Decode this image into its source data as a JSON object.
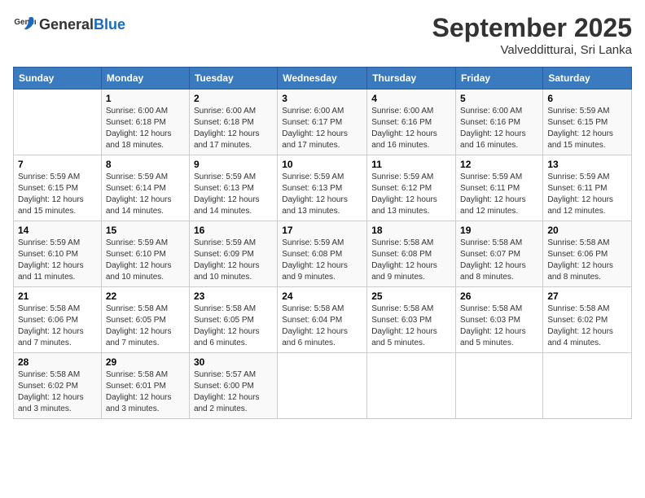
{
  "logo": {
    "general": "General",
    "blue": "Blue"
  },
  "title": "September 2025",
  "subtitle": "Valvedditturai, Sri Lanka",
  "days_of_week": [
    "Sunday",
    "Monday",
    "Tuesday",
    "Wednesday",
    "Thursday",
    "Friday",
    "Saturday"
  ],
  "weeks": [
    [
      {
        "day": "",
        "info": ""
      },
      {
        "day": "1",
        "info": "Sunrise: 6:00 AM\nSunset: 6:18 PM\nDaylight: 12 hours\nand 18 minutes."
      },
      {
        "day": "2",
        "info": "Sunrise: 6:00 AM\nSunset: 6:18 PM\nDaylight: 12 hours\nand 17 minutes."
      },
      {
        "day": "3",
        "info": "Sunrise: 6:00 AM\nSunset: 6:17 PM\nDaylight: 12 hours\nand 17 minutes."
      },
      {
        "day": "4",
        "info": "Sunrise: 6:00 AM\nSunset: 6:16 PM\nDaylight: 12 hours\nand 16 minutes."
      },
      {
        "day": "5",
        "info": "Sunrise: 6:00 AM\nSunset: 6:16 PM\nDaylight: 12 hours\nand 16 minutes."
      },
      {
        "day": "6",
        "info": "Sunrise: 5:59 AM\nSunset: 6:15 PM\nDaylight: 12 hours\nand 15 minutes."
      }
    ],
    [
      {
        "day": "7",
        "info": "Sunrise: 5:59 AM\nSunset: 6:15 PM\nDaylight: 12 hours\nand 15 minutes."
      },
      {
        "day": "8",
        "info": "Sunrise: 5:59 AM\nSunset: 6:14 PM\nDaylight: 12 hours\nand 14 minutes."
      },
      {
        "day": "9",
        "info": "Sunrise: 5:59 AM\nSunset: 6:13 PM\nDaylight: 12 hours\nand 14 minutes."
      },
      {
        "day": "10",
        "info": "Sunrise: 5:59 AM\nSunset: 6:13 PM\nDaylight: 12 hours\nand 13 minutes."
      },
      {
        "day": "11",
        "info": "Sunrise: 5:59 AM\nSunset: 6:12 PM\nDaylight: 12 hours\nand 13 minutes."
      },
      {
        "day": "12",
        "info": "Sunrise: 5:59 AM\nSunset: 6:11 PM\nDaylight: 12 hours\nand 12 minutes."
      },
      {
        "day": "13",
        "info": "Sunrise: 5:59 AM\nSunset: 6:11 PM\nDaylight: 12 hours\nand 12 minutes."
      }
    ],
    [
      {
        "day": "14",
        "info": "Sunrise: 5:59 AM\nSunset: 6:10 PM\nDaylight: 12 hours\nand 11 minutes."
      },
      {
        "day": "15",
        "info": "Sunrise: 5:59 AM\nSunset: 6:10 PM\nDaylight: 12 hours\nand 10 minutes."
      },
      {
        "day": "16",
        "info": "Sunrise: 5:59 AM\nSunset: 6:09 PM\nDaylight: 12 hours\nand 10 minutes."
      },
      {
        "day": "17",
        "info": "Sunrise: 5:59 AM\nSunset: 6:08 PM\nDaylight: 12 hours\nand 9 minutes."
      },
      {
        "day": "18",
        "info": "Sunrise: 5:58 AM\nSunset: 6:08 PM\nDaylight: 12 hours\nand 9 minutes."
      },
      {
        "day": "19",
        "info": "Sunrise: 5:58 AM\nSunset: 6:07 PM\nDaylight: 12 hours\nand 8 minutes."
      },
      {
        "day": "20",
        "info": "Sunrise: 5:58 AM\nSunset: 6:06 PM\nDaylight: 12 hours\nand 8 minutes."
      }
    ],
    [
      {
        "day": "21",
        "info": "Sunrise: 5:58 AM\nSunset: 6:06 PM\nDaylight: 12 hours\nand 7 minutes."
      },
      {
        "day": "22",
        "info": "Sunrise: 5:58 AM\nSunset: 6:05 PM\nDaylight: 12 hours\nand 7 minutes."
      },
      {
        "day": "23",
        "info": "Sunrise: 5:58 AM\nSunset: 6:05 PM\nDaylight: 12 hours\nand 6 minutes."
      },
      {
        "day": "24",
        "info": "Sunrise: 5:58 AM\nSunset: 6:04 PM\nDaylight: 12 hours\nand 6 minutes."
      },
      {
        "day": "25",
        "info": "Sunrise: 5:58 AM\nSunset: 6:03 PM\nDaylight: 12 hours\nand 5 minutes."
      },
      {
        "day": "26",
        "info": "Sunrise: 5:58 AM\nSunset: 6:03 PM\nDaylight: 12 hours\nand 5 minutes."
      },
      {
        "day": "27",
        "info": "Sunrise: 5:58 AM\nSunset: 6:02 PM\nDaylight: 12 hours\nand 4 minutes."
      }
    ],
    [
      {
        "day": "28",
        "info": "Sunrise: 5:58 AM\nSunset: 6:02 PM\nDaylight: 12 hours\nand 3 minutes."
      },
      {
        "day": "29",
        "info": "Sunrise: 5:58 AM\nSunset: 6:01 PM\nDaylight: 12 hours\nand 3 minutes."
      },
      {
        "day": "30",
        "info": "Sunrise: 5:57 AM\nSunset: 6:00 PM\nDaylight: 12 hours\nand 2 minutes."
      },
      {
        "day": "",
        "info": ""
      },
      {
        "day": "",
        "info": ""
      },
      {
        "day": "",
        "info": ""
      },
      {
        "day": "",
        "info": ""
      }
    ]
  ]
}
